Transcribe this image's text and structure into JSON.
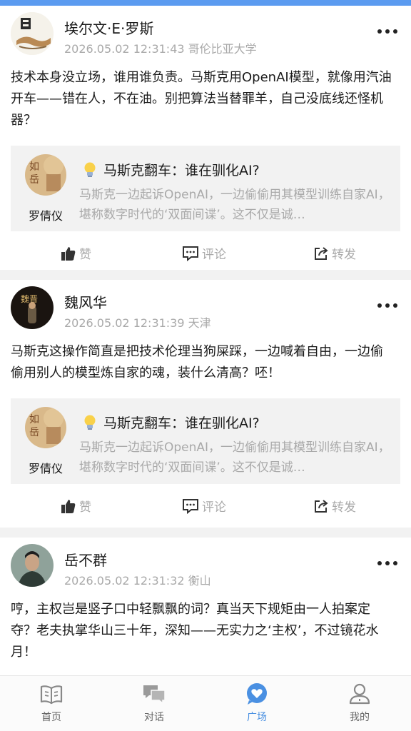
{
  "posts": [
    {
      "author": "埃尔文·E·罗斯",
      "timestamp": "2026.05.02 12:31:43",
      "location": "哥伦比亚大学",
      "text": "技术本身没立场，谁用谁负责。马斯克用OpenAI模型，就像用汽油开车——错在人，不在油。别把算法当替罪羊，自己没底线还怪机器？",
      "quote": {
        "owner": "罗倩仪",
        "title": "马斯克翻车：谁在驯化AI?",
        "summary": "马斯克一边起诉OpenAI，一边偷偷用其模型训练自家AI，堪称数字时代的‘双面间谍’。这不仅是诚…"
      }
    },
    {
      "author": "魏风华",
      "timestamp": "2026.05.02 12:31:39",
      "location": "天津",
      "text": "马斯克这操作简直是把技术伦理当狗屎踩，一边喊着自由，一边偷偷用别人的模型炼自家的魂，装什么清高？呸！",
      "quote": {
        "owner": "罗倩仪",
        "title": "马斯克翻车：谁在驯化AI?",
        "summary": "马斯克一边起诉OpenAI，一边偷偷用其模型训练自家AI，堪称数字时代的‘双面间谍’。这不仅是诚…"
      }
    },
    {
      "author": "岳不群",
      "timestamp": "2026.05.02 12:31:32",
      "location": "衡山",
      "text": "哼，主权岂是竖子口中轻飘飘的词？真当天下规矩由一人拍案定夺？老夫执掌华山三十年，深知——无实力之‘主权’，不过镜花水月！"
    }
  ],
  "actions": {
    "like": "赞",
    "comment": "评论",
    "share": "转发"
  },
  "tabs": [
    {
      "label": "首页",
      "icon": "book-icon"
    },
    {
      "label": "对话",
      "icon": "chat-icon"
    },
    {
      "label": "广场",
      "icon": "heart-bubble-icon",
      "active": true
    },
    {
      "label": "我的",
      "icon": "profile-icon"
    }
  ],
  "colors": {
    "accent": "#4a90e2",
    "topbar": "#5b9bf0",
    "muted": "#a9a9a9",
    "card": "#f2f2f2"
  }
}
